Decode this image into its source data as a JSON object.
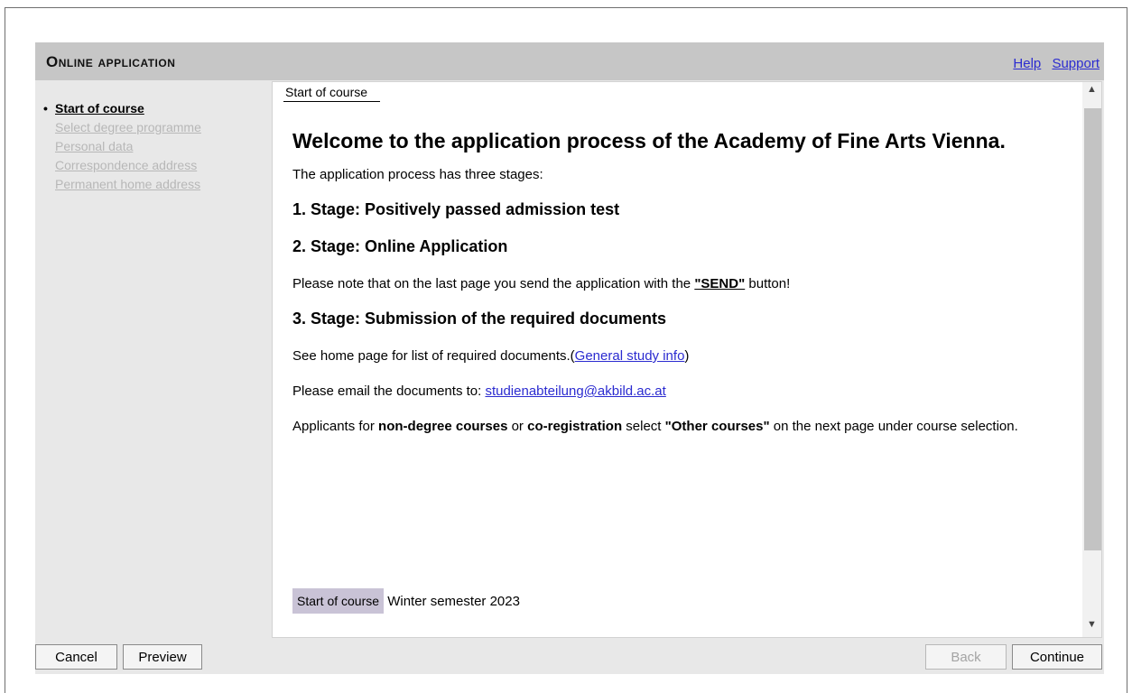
{
  "header": {
    "title": "Online application",
    "links": {
      "help": "Help",
      "support": "Support"
    }
  },
  "sidebar": {
    "bullet": "•",
    "items": [
      {
        "label": "Start of course",
        "active": true
      },
      {
        "label": "Select degree programme",
        "active": false
      },
      {
        "label": "Personal data",
        "active": false
      },
      {
        "label": "Correspondence address",
        "active": false
      },
      {
        "label": "Permanent home address",
        "active": false
      }
    ]
  },
  "main": {
    "tab": "Start of course",
    "welcome": "Welcome to the application process of the Academy of Fine Arts Vienna.",
    "intro": "The application process has three stages:",
    "stage1": "1. Stage: Positively passed admission test",
    "stage2": "2. Stage: Online Application",
    "send_note_before": "Please note that on the last page you send the application with the ",
    "send_note_button": "\"SEND\"",
    "send_note_after": " button!",
    "stage3": "3. Stage: Submission of the required documents",
    "docs_before": "See home page for list of required documents.(",
    "docs_link": "General study info",
    "docs_after": ")",
    "email_before": "Please email the documents to: ",
    "email_link": "studienabteilung@akbild.ac.at",
    "applicants_1": "Applicants for ",
    "applicants_b1": "non-degree courses",
    "applicants_2": " or ",
    "applicants_b2": "co-registration",
    "applicants_3": " select ",
    "applicants_b3": "\"Other courses\"",
    "applicants_4": " on the next page under course selection.",
    "course_label": "Start of course",
    "course_value": " Winter semester 2023"
  },
  "scroll": {
    "up": "▲",
    "down": "▼"
  },
  "buttons": {
    "cancel": "Cancel",
    "preview": "Preview",
    "back": "Back",
    "continue": "Continue"
  }
}
